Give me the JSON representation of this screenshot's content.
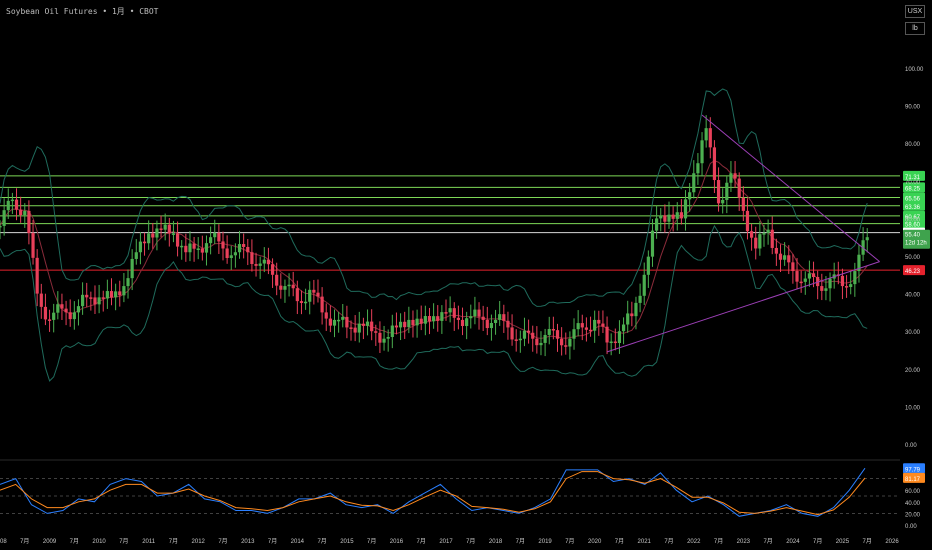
{
  "header": {
    "title": "Soybean Oil Futures • 1月 • CBOT"
  },
  "units": {
    "currency": "USX",
    "measure": "lb"
  },
  "colors": {
    "up": "#4caf50",
    "down": "#e8405a",
    "background": "#000000",
    "bollinger": "#1f6b5c",
    "midline": "#8a2b3a",
    "support": "#e5222d",
    "resistance": "#7ed957",
    "trendline": "#9b3fb5",
    "stoch_k": "#2a7fff",
    "stoch_d": "#ff8a1f",
    "axis_text": "#c8c8c8"
  },
  "chart_data": [
    {
      "type": "candlestick",
      "title": "Soybean Oil Futures • 1月 • CBOT",
      "yunit": "USX/lb",
      "ylim": [
        -2,
        112
      ],
      "y_ticks": [
        "100.00",
        "90.00",
        "80.00",
        "70.00",
        "60.00",
        "50.00",
        "40.00",
        "30.00",
        "20.00",
        "10.00",
        "0.00"
      ],
      "x_ticks": [
        "2008",
        "7月",
        "2009",
        "7月",
        "2010",
        "7月",
        "2011",
        "7月",
        "2012",
        "7月",
        "2013",
        "7月",
        "2014",
        "7月",
        "2015",
        "7月",
        "2016",
        "7月",
        "2017",
        "7月",
        "2018",
        "7月",
        "2019",
        "7月",
        "2020",
        "7月",
        "2021",
        "7月",
        "2022",
        "7月",
        "2023",
        "7月",
        "2024",
        "7月",
        "2025",
        "7月",
        "2026"
      ],
      "x_range": [
        "2008-01",
        "2026-01"
      ],
      "grid": false,
      "horizontal_levels": [
        {
          "label": "71.31",
          "kind": "resistance"
        },
        {
          "label": "68.25",
          "kind": "resistance"
        },
        {
          "label": "65.56",
          "kind": "resistance"
        },
        {
          "label": "63.36",
          "kind": "resistance"
        },
        {
          "label": "60.67",
          "kind": "resistance"
        },
        {
          "label": "58.60",
          "kind": "resistance"
        },
        {
          "label": "56.23",
          "kind": "neutral"
        },
        {
          "label": "46.23",
          "kind": "support"
        }
      ],
      "last_price": {
        "label": "55.40",
        "countdown": "12d 12h"
      },
      "trendlines": [
        {
          "from": [
            "2022-03",
            87.5
          ],
          "to": [
            "2025-10",
            48.5
          ]
        },
        {
          "from": [
            "2020-04",
            24.5
          ],
          "to": [
            "2025-10",
            48.5
          ]
        }
      ],
      "series": {
        "close": [
          [
            "2008-01",
            58
          ],
          [
            "2008-04",
            65
          ],
          [
            "2008-07",
            62
          ],
          [
            "2008-10",
            40
          ],
          [
            "2009-01",
            33
          ],
          [
            "2009-04",
            36
          ],
          [
            "2009-07",
            35
          ],
          [
            "2009-10",
            39
          ],
          [
            "2010-01",
            39
          ],
          [
            "2010-04",
            39
          ],
          [
            "2010-07",
            42
          ],
          [
            "2010-10",
            51
          ],
          [
            "2011-01",
            56
          ],
          [
            "2011-04",
            57
          ],
          [
            "2011-07",
            56
          ],
          [
            "2011-10",
            51
          ],
          [
            "2012-01",
            52
          ],
          [
            "2012-04",
            55
          ],
          [
            "2012-07",
            52
          ],
          [
            "2012-10",
            51
          ],
          [
            "2013-01",
            51
          ],
          [
            "2013-04",
            48
          ],
          [
            "2013-07",
            45
          ],
          [
            "2013-10",
            42
          ],
          [
            "2014-01",
            38
          ],
          [
            "2014-04",
            41
          ],
          [
            "2014-07",
            35
          ],
          [
            "2014-10",
            33
          ],
          [
            "2015-01",
            31
          ],
          [
            "2015-04",
            32
          ],
          [
            "2015-07",
            30
          ],
          [
            "2015-10",
            28
          ],
          [
            "2016-01",
            31
          ],
          [
            "2016-04",
            33
          ],
          [
            "2016-07",
            32
          ],
          [
            "2016-10",
            34
          ],
          [
            "2017-01",
            35
          ],
          [
            "2017-04",
            33
          ],
          [
            "2017-07",
            34
          ],
          [
            "2017-10",
            33
          ],
          [
            "2018-01",
            33
          ],
          [
            "2018-04",
            31
          ],
          [
            "2018-07",
            28
          ],
          [
            "2018-10",
            28
          ],
          [
            "2019-01",
            29
          ],
          [
            "2019-04",
            28
          ],
          [
            "2019-07",
            28
          ],
          [
            "2019-10",
            31
          ],
          [
            "2020-01",
            33
          ],
          [
            "2020-04",
            27
          ],
          [
            "2020-07",
            30
          ],
          [
            "2020-10",
            34
          ],
          [
            "2021-01",
            45
          ],
          [
            "2021-04",
            60
          ],
          [
            "2021-07",
            61
          ],
          [
            "2021-10",
            60
          ],
          [
            "2022-01",
            72
          ],
          [
            "2022-04",
            84
          ],
          [
            "2022-07",
            64
          ],
          [
            "2022-10",
            72
          ],
          [
            "2023-01",
            62
          ],
          [
            "2023-04",
            52
          ],
          [
            "2023-07",
            57
          ],
          [
            "2023-10",
            49
          ],
          [
            "2024-01",
            46
          ],
          [
            "2024-04",
            44
          ],
          [
            "2024-07",
            42
          ],
          [
            "2024-10",
            44
          ],
          [
            "2025-01",
            42
          ],
          [
            "2025-04",
            46
          ],
          [
            "2025-07",
            55
          ]
        ]
      }
    },
    {
      "type": "line",
      "title": "",
      "ylim": [
        0,
        100
      ],
      "y_ticks": [
        "60.00",
        "40.00",
        "20.00",
        "0.00"
      ],
      "last_values": [
        "97.79",
        "81.17"
      ],
      "series": [
        {
          "values": [
            70,
            80,
            35,
            20,
            25,
            45,
            40,
            70,
            80,
            75,
            50,
            55,
            70,
            45,
            40,
            25,
            25,
            20,
            30,
            45,
            45,
            55,
            35,
            30,
            35,
            20,
            40,
            55,
            70,
            45,
            25,
            30,
            25,
            20,
            30,
            45,
            95,
            95,
            95,
            75,
            80,
            70,
            90,
            60,
            40,
            50,
            35,
            15,
            20,
            25,
            35,
            20,
            15,
            30,
            60,
            98
          ]
        },
        {
          "values": [
            60,
            70,
            45,
            30,
            30,
            40,
            45,
            60,
            70,
            70,
            55,
            55,
            62,
            50,
            42,
            30,
            28,
            25,
            30,
            40,
            45,
            50,
            40,
            34,
            33,
            25,
            35,
            48,
            60,
            50,
            32,
            30,
            27,
            22,
            28,
            40,
            80,
            92,
            92,
            80,
            78,
            72,
            80,
            65,
            48,
            48,
            38,
            22,
            20,
            24,
            30,
            24,
            18,
            26,
            48,
            81
          ]
        }
      ]
    }
  ]
}
